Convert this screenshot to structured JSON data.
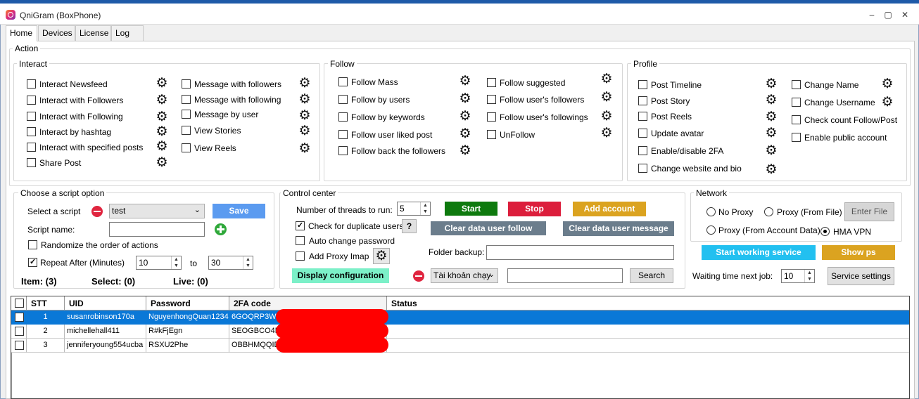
{
  "window": {
    "title": "QniGram (BoxPhone)",
    "controls": [
      "–",
      "▢",
      "✕"
    ]
  },
  "tabs": [
    "Home",
    "Devices",
    "License",
    "Log"
  ],
  "action": {
    "label": "Action",
    "interact": {
      "label": "Interact",
      "col1": [
        "Interact Newsfeed",
        "Interact with Followers",
        "Interact with Following",
        "Interact by hashtag",
        "Interact with specified posts",
        "Share Post"
      ],
      "col2": [
        "Message with followers",
        "Message with following",
        "Message by user",
        "View Stories",
        "View Reels"
      ]
    },
    "follow": {
      "label": "Follow",
      "col1": [
        "Follow Mass",
        "Follow by users",
        "Follow by keywords",
        "Follow user liked post",
        "Follow back the followers"
      ],
      "col2": [
        "Follow suggested",
        "Follow user's followers",
        "Follow user's followings",
        "UnFollow"
      ]
    },
    "profile": {
      "label": "Profile",
      "col1": [
        "Post Timeline",
        "Post Story",
        "Post Reels",
        "Update avatar",
        "Enable/disable 2FA",
        "Change website and bio"
      ],
      "col2": [
        "Change Name",
        "Change Username",
        "Check count Follow/Post",
        "Enable public account"
      ]
    }
  },
  "script": {
    "label": "Choose a script option",
    "select_label": "Select a script",
    "selected": "test",
    "save": "Save",
    "name_label": "Script name:",
    "randomize": "Randomize the order of actions",
    "repeat": "Repeat After (Minutes)",
    "from": "10",
    "to_label": "to",
    "to": "30"
  },
  "control": {
    "label": "Control center",
    "threads_label": "Number of threads to run:",
    "threads": "5",
    "start": "Start",
    "stop": "Stop",
    "add_account": "Add account",
    "dup_check": "Check for duplicate users",
    "help": "?",
    "clear_follow": "Clear data user follow",
    "clear_message": "Clear data user message",
    "auto_pw": "Auto change password",
    "proxy_imap": "Add Proxy Imap",
    "folder_label": "Folder backup:",
    "display_config": "Display configuration",
    "account_filter": "Tài khoản chạy",
    "search": "Search"
  },
  "network": {
    "label": "Network",
    "no_proxy": "No Proxy",
    "proxy_file": "Proxy (From File)",
    "enter_file": "Enter File",
    "proxy_account": "Proxy (From Account Data)",
    "hma": "HMA VPN",
    "start_service": "Start working service",
    "show_ps": "Show ps",
    "waiting_label": "Waiting time next job:",
    "waiting": "10",
    "service_settings": "Service settings"
  },
  "stats": {
    "items": "Item: (3)",
    "select": "Select: (0)",
    "live": "Live: (0)"
  },
  "table": {
    "headers": [
      "STT",
      "UID",
      "Password",
      "2FA code",
      "Status"
    ],
    "rows": [
      {
        "stt": "1",
        "uid": "susanrobinson170a",
        "password": "NguyenhongQuan1234",
        "code": "6GOQRP3WK",
        "status": ""
      },
      {
        "stt": "2",
        "uid": "michellehall411",
        "password": "R#kFjEgn",
        "code": "SEOGBCO4R",
        "status": ""
      },
      {
        "stt": "3",
        "uid": "jenniferyoung554ucba",
        "password": "RSXU2Phe",
        "code": "OBBHMQQID",
        "status": ""
      }
    ]
  },
  "colors": {
    "start": "#0e7a0e",
    "stop": "#dc1e3c",
    "add": "#dba320",
    "gray": "#6b7d8c",
    "save": "#5b9bf0",
    "cyan": "#22c0f0",
    "config": "#7cf0c8"
  }
}
